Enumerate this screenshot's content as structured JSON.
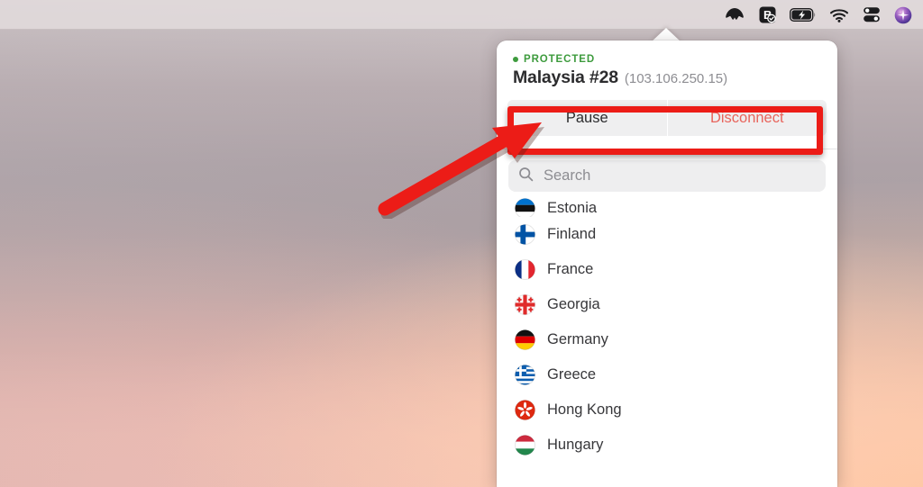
{
  "menubar": {
    "icons": [
      {
        "name": "nordvpn-menu-icon",
        "label": "NordVPN"
      },
      {
        "name": "bitwarden-menu-icon",
        "label": "Bitwarden"
      },
      {
        "name": "battery-charging-icon",
        "label": "Battery charging"
      },
      {
        "name": "wifi-icon",
        "label": "Wi-Fi"
      },
      {
        "name": "control-center-icon",
        "label": "Control Center"
      },
      {
        "name": "siri-icon",
        "label": "Siri"
      }
    ]
  },
  "popover": {
    "status_label": "PROTECTED",
    "status_color": "#3d9b3d",
    "server_name": "Malaysia #28",
    "server_ip": "(103.106.250.15)",
    "pause_label": "Pause",
    "disconnect_label": "Disconnect",
    "disconnect_color": "#e8645c",
    "search": {
      "placeholder": "Search",
      "value": ""
    },
    "countries": [
      {
        "name": "Estonia",
        "flag": "estonia-flag-icon",
        "clipped": true
      },
      {
        "name": "Finland",
        "flag": "finland-flag-icon",
        "clipped": false
      },
      {
        "name": "France",
        "flag": "france-flag-icon",
        "clipped": false
      },
      {
        "name": "Georgia",
        "flag": "georgia-flag-icon",
        "clipped": false
      },
      {
        "name": "Germany",
        "flag": "germany-flag-icon",
        "clipped": false
      },
      {
        "name": "Greece",
        "flag": "greece-flag-icon",
        "clipped": false
      },
      {
        "name": "Hong Kong",
        "flag": "hong-kong-flag-icon",
        "clipped": false
      },
      {
        "name": "Hungary",
        "flag": "hungary-flag-icon",
        "clipped": false
      }
    ]
  },
  "annotations": {
    "highlight_color": "#ec1c17",
    "arrow_color": "#ec1c17"
  }
}
